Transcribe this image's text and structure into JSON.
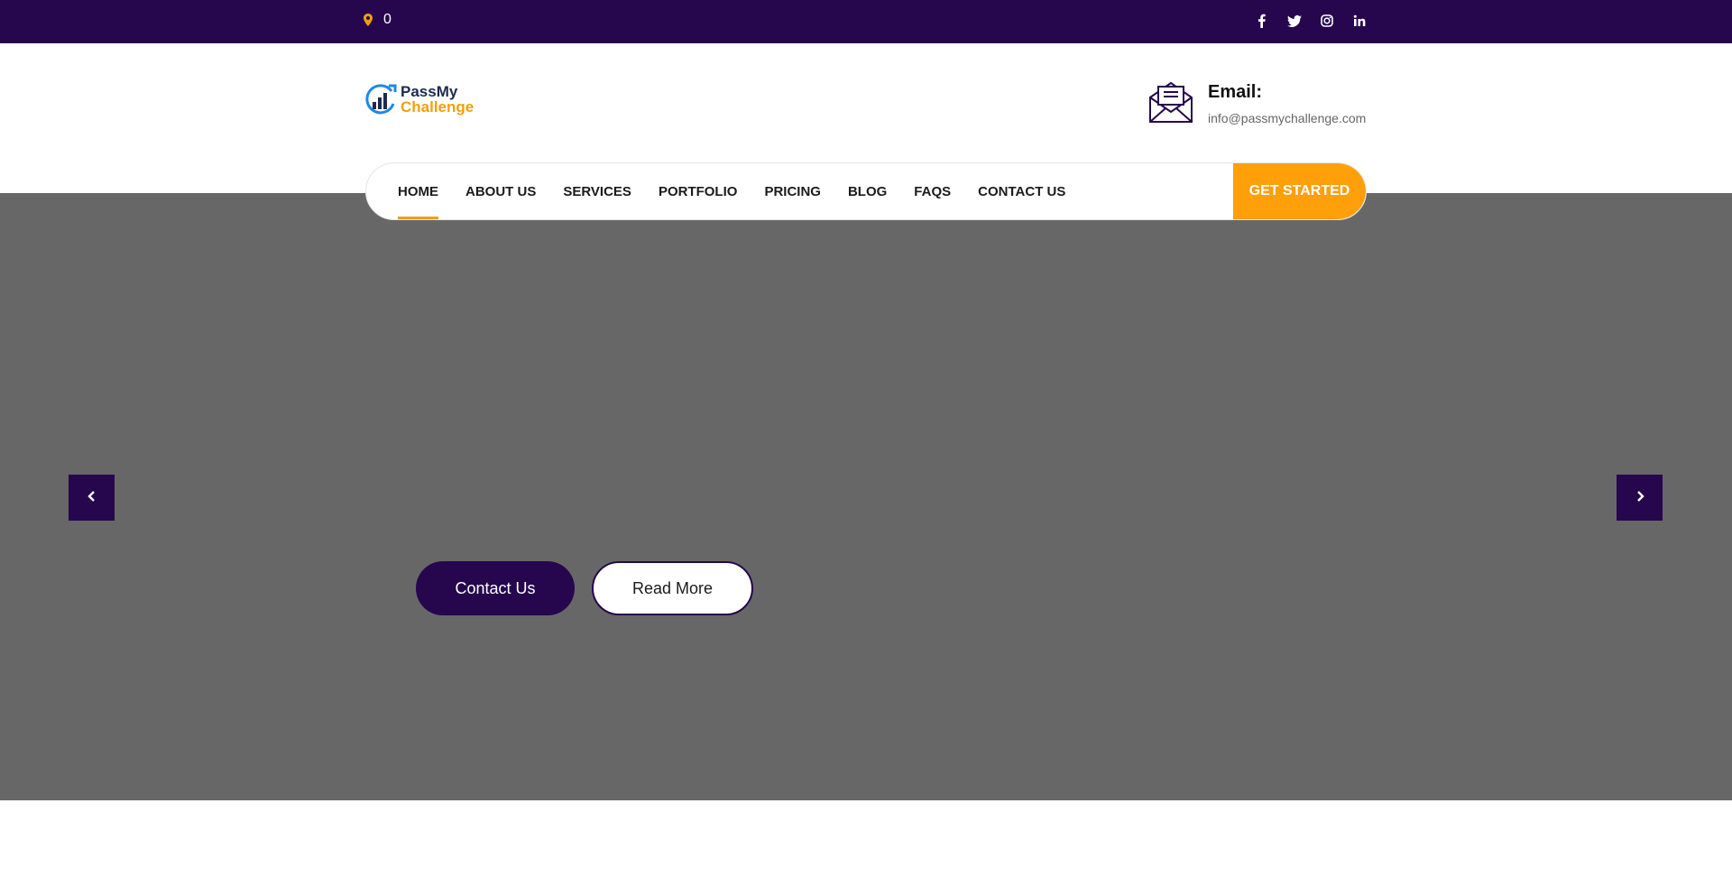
{
  "topbar": {
    "location_text": "0",
    "social": [
      "facebook-icon",
      "twitter-icon",
      "instagram-icon",
      "linkedin-icon"
    ]
  },
  "header": {
    "logo": {
      "line1": "PassMy",
      "line2": "Challenge"
    },
    "contact": {
      "label": "Email:",
      "value": "info@passmychallenge.com"
    }
  },
  "nav": {
    "items": [
      "HOME",
      "ABOUT US",
      "SERVICES",
      "PORTFOLIO",
      "PRICING",
      "BLOG",
      "FAQS",
      "CONTACT US"
    ],
    "active_index": 0,
    "cta": "GET STARTED"
  },
  "hero": {
    "primary_button": "Contact Us",
    "secondary_button": "Read More"
  },
  "colors": {
    "topbar": "#26074d",
    "accent": "#f49f0a",
    "hero_bg": "#676767"
  }
}
